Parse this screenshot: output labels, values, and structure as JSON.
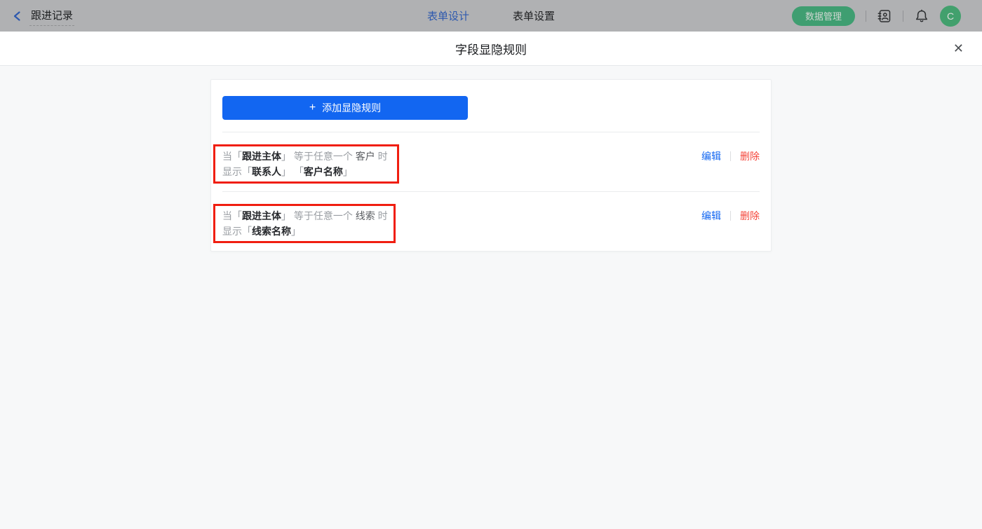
{
  "topbar": {
    "back_label": "跟进记录",
    "tabs": [
      {
        "label": "表单设计"
      },
      {
        "label": "表单设置"
      }
    ],
    "data_manage_label": "数据管理",
    "avatar_letter": "C"
  },
  "modal": {
    "title": "字段显隐规则",
    "close_glyph": "✕"
  },
  "panel": {
    "add_button": {
      "plus": "+",
      "label": "添加显隐规则"
    },
    "ui": {
      "bracket_open": "「",
      "bracket_close": "」"
    },
    "rules": [
      {
        "when": "当",
        "condition_field": "跟进主体",
        "operator": "等于任意一个",
        "value": "客户",
        "then_suffix": "时",
        "action": "显示",
        "show_fields": [
          "联系人",
          "客户名称"
        ],
        "edit_label": "编辑",
        "delete_label": "删除"
      },
      {
        "when": "当",
        "condition_field": "跟进主体",
        "operator": "等于任意一个",
        "value": "线索",
        "then_suffix": "时",
        "action": "显示",
        "show_fields": [
          "线索名称"
        ],
        "edit_label": "编辑",
        "delete_label": "删除"
      }
    ]
  },
  "colors": {
    "accent-blue": "#1266f1",
    "delete-red": "#f4453a",
    "annotation-red": "#f01e10",
    "topbar-green": "#3f9e71",
    "topbar-blue": "#2e59ae"
  }
}
